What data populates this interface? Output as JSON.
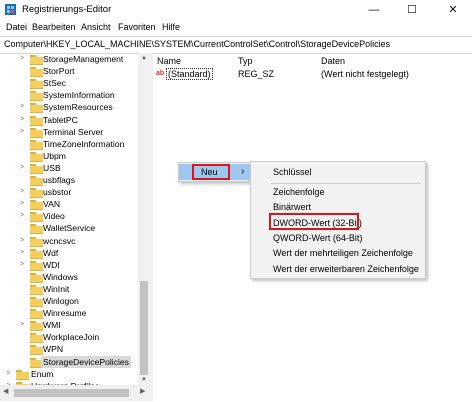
{
  "window": {
    "title": "Registrierungs-Editor",
    "minimize": "—",
    "maximize": "☐",
    "close": "✕"
  },
  "menubar": [
    "Datei",
    "Bearbeiten",
    "Ansicht",
    "Favoriten",
    "Hilfe"
  ],
  "address": "Computer\\HKEY_LOCAL_MACHINE\\SYSTEM\\CurrentControlSet\\Control\\StorageDevicePolicies",
  "tree": {
    "items": [
      {
        "label": "StorageManagement",
        "expandable": true
      },
      {
        "label": "StorPort",
        "expandable": false
      },
      {
        "label": "StSec",
        "expandable": false
      },
      {
        "label": "SystemInformation",
        "expandable": false
      },
      {
        "label": "SystemResources",
        "expandable": true
      },
      {
        "label": "TabletPC",
        "expandable": true
      },
      {
        "label": "Terminal Server",
        "expandable": true
      },
      {
        "label": "TimeZoneInformation",
        "expandable": false
      },
      {
        "label": "Ubpm",
        "expandable": false
      },
      {
        "label": "USB",
        "expandable": true
      },
      {
        "label": "usbflags",
        "expandable": false
      },
      {
        "label": "usbstor",
        "expandable": true
      },
      {
        "label": "VAN",
        "expandable": true
      },
      {
        "label": "Video",
        "expandable": true
      },
      {
        "label": "WalletService",
        "expandable": false
      },
      {
        "label": "wcncsvc",
        "expandable": true
      },
      {
        "label": "Wdf",
        "expandable": true
      },
      {
        "label": "WDI",
        "expandable": true
      },
      {
        "label": "Windows",
        "expandable": false
      },
      {
        "label": "WinInit",
        "expandable": false
      },
      {
        "label": "Winlogon",
        "expandable": false
      },
      {
        "label": "Winresume",
        "expandable": false
      },
      {
        "label": "WMI",
        "expandable": true
      },
      {
        "label": "WorkplaceJoin",
        "expandable": false
      },
      {
        "label": "WPN",
        "expandable": false
      },
      {
        "label": "StorageDevicePolicies",
        "expandable": false,
        "selected": true
      },
      {
        "label": "Enum",
        "expandable": true,
        "level": 0
      },
      {
        "label": "Hardware Profiles",
        "expandable": true,
        "level": 0
      }
    ]
  },
  "list": {
    "columns": [
      "Name",
      "Typ",
      "Daten"
    ],
    "rows": [
      {
        "icon": "ab",
        "name": "(Standard)",
        "type": "REG_SZ",
        "data": "(Wert nicht festgelegt)"
      }
    ]
  },
  "context_menu": {
    "main_item": "Neu",
    "submenu_arrow": "›",
    "submenu": [
      "Schlüssel",
      "Zeichenfolge",
      "Binärwert",
      "DWORD-Wert (32-Bit)",
      "QWORD-Wert (64-Bit)",
      "Wert der mehrteiligen Zeichenfolge",
      "Wert der erweiterbaren Zeichenfolge"
    ]
  },
  "colors": {
    "highlight_box": "#d9161f",
    "hover": "#9fc7ee",
    "folder": "#f2cf5f"
  }
}
